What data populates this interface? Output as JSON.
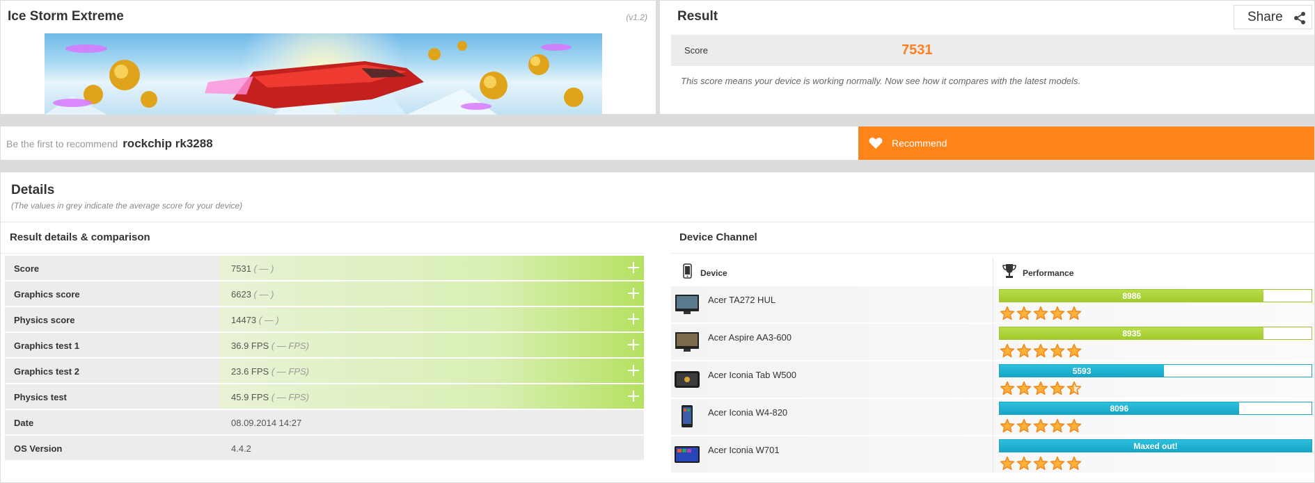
{
  "test": {
    "title": "Ice Storm Extreme",
    "version": "(v1.2)"
  },
  "result": {
    "title": "Result",
    "share_label": "Share",
    "score_label": "Score",
    "score_value": "7531",
    "description": "This score means your device is working normally. Now see how it compares with the latest models."
  },
  "recommend": {
    "prefix": "Be the first to recommend",
    "device": "rockchip rk3288",
    "button_label": "Recommend"
  },
  "details": {
    "title": "Details",
    "subtitle": "(The values in grey indicate the average score for your device)",
    "left_title": "Result details & comparison",
    "right_title": "Device Channel",
    "rows": [
      {
        "label": "Score",
        "value": "7531",
        "avg": "( — )"
      },
      {
        "label": "Graphics score",
        "value": "6623",
        "avg": "( — )"
      },
      {
        "label": "Physics score",
        "value": "14473",
        "avg": "( — )"
      },
      {
        "label": "Graphics test 1",
        "value": "36.9 FPS",
        "avg": "( — FPS)"
      },
      {
        "label": "Graphics test 2",
        "value": "23.6 FPS",
        "avg": "( — FPS)"
      },
      {
        "label": "Physics test",
        "value": "45.9 FPS",
        "avg": "( — FPS)"
      },
      {
        "label": "Date",
        "value": "08.09.2014 14:27",
        "avg": ""
      },
      {
        "label": "OS Version",
        "value": "4.4.2",
        "avg": ""
      }
    ]
  },
  "device_channel": {
    "col_device": "Device",
    "col_performance": "Performance",
    "devices": [
      {
        "name": "Acer TA272 HUL",
        "score": "8986",
        "fill": 0.847,
        "color": "green",
        "stars": 5
      },
      {
        "name": "Acer Aspire AA3-600",
        "score": "8935",
        "fill": 0.847,
        "color": "green",
        "stars": 5
      },
      {
        "name": "Acer Iconia Tab W500",
        "score": "5593",
        "fill": 0.527,
        "color": "blue",
        "stars": 4.5
      },
      {
        "name": "Acer Iconia W4-820",
        "score": "8096",
        "fill": 0.767,
        "color": "blue",
        "stars": 5
      },
      {
        "name": "Acer Iconia W701",
        "score": "Maxed out!",
        "fill": 1.0,
        "color": "blue",
        "stars": 5
      }
    ]
  },
  "colors": {
    "accent": "#ff7f1e",
    "green_bar": "#a7d034",
    "blue_bar": "#1fb2d2"
  }
}
